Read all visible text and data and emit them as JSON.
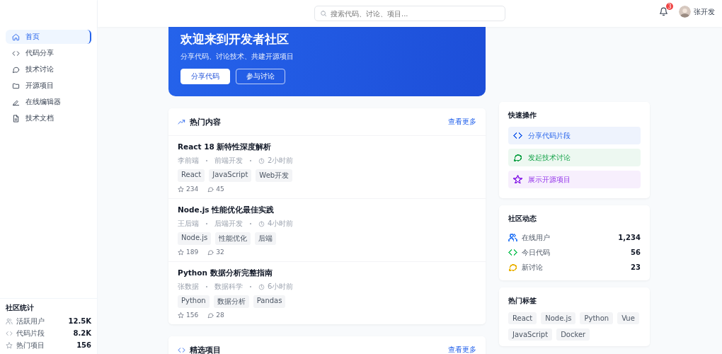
{
  "sidebar": {
    "nav": [
      {
        "label": "首页",
        "selected": true
      },
      {
        "label": "代码分享",
        "selected": false
      },
      {
        "label": "技术讨论",
        "selected": false
      },
      {
        "label": "开源项目",
        "selected": false
      },
      {
        "label": "在线编辑器",
        "selected": false
      },
      {
        "label": "技术文档",
        "selected": false
      }
    ],
    "stats": {
      "title": "社区统计",
      "items": [
        {
          "label": "活跃用户",
          "value": "12.5K"
        },
        {
          "label": "代码片段",
          "value": "8.2K"
        },
        {
          "label": "热门项目",
          "value": "156"
        }
      ]
    }
  },
  "header": {
    "search": {
      "placeholder": "搜索代码、讨论、项目..."
    },
    "notifications": "3",
    "user": "张开发"
  },
  "hero": {
    "title": "欢迎来到开发者社区",
    "subtitle": "分享代码、讨论技术、共建开源项目",
    "buttons": [
      {
        "label": "分享代码",
        "kind": "primary"
      },
      {
        "label": "参与讨论",
        "kind": "outline"
      }
    ]
  },
  "hot": {
    "title": "热门内容",
    "more": "查看更多",
    "posts": [
      {
        "title": "React 18 新特性深度解析",
        "author": "李前端",
        "category": "前端开发",
        "time": "2小时前",
        "tags": [
          "React",
          "JavaScript",
          "Web开发"
        ],
        "likes": "234",
        "comments": "45"
      },
      {
        "title": "Node.js 性能优化最佳实践",
        "author": "王后端",
        "category": "后端开发",
        "time": "4小时前",
        "tags": [
          "Node.js",
          "性能优化",
          "后端"
        ],
        "likes": "189",
        "comments": "32"
      },
      {
        "title": "Python 数据分析完整指南",
        "author": "张数据",
        "category": "数据科学",
        "time": "6小时前",
        "tags": [
          "Python",
          "数据分析",
          "Pandas"
        ],
        "likes": "156",
        "comments": "28"
      }
    ]
  },
  "featured": {
    "title": "精选项目",
    "more": "查看更多"
  },
  "quick": {
    "title": "快速操作",
    "actions": [
      {
        "label": "分享代码片段",
        "color": "#2563eb"
      },
      {
        "label": "发起技术讨论",
        "color": "#16a34a"
      },
      {
        "label": "展示开源项目",
        "color": "#9333ea"
      }
    ]
  },
  "activity": {
    "title": "社区动态",
    "rows": [
      {
        "label": "在线用户",
        "value": "1,234",
        "color": "#3b82f6"
      },
      {
        "label": "今日代码",
        "value": "56",
        "color": "#22c55e"
      },
      {
        "label": "新讨论",
        "value": "23",
        "color": "#eab308"
      }
    ]
  },
  "tags": {
    "title": "热门标签",
    "items": [
      "React",
      "Node.js",
      "Python",
      "Vue",
      "JavaScript",
      "Docker"
    ]
  }
}
